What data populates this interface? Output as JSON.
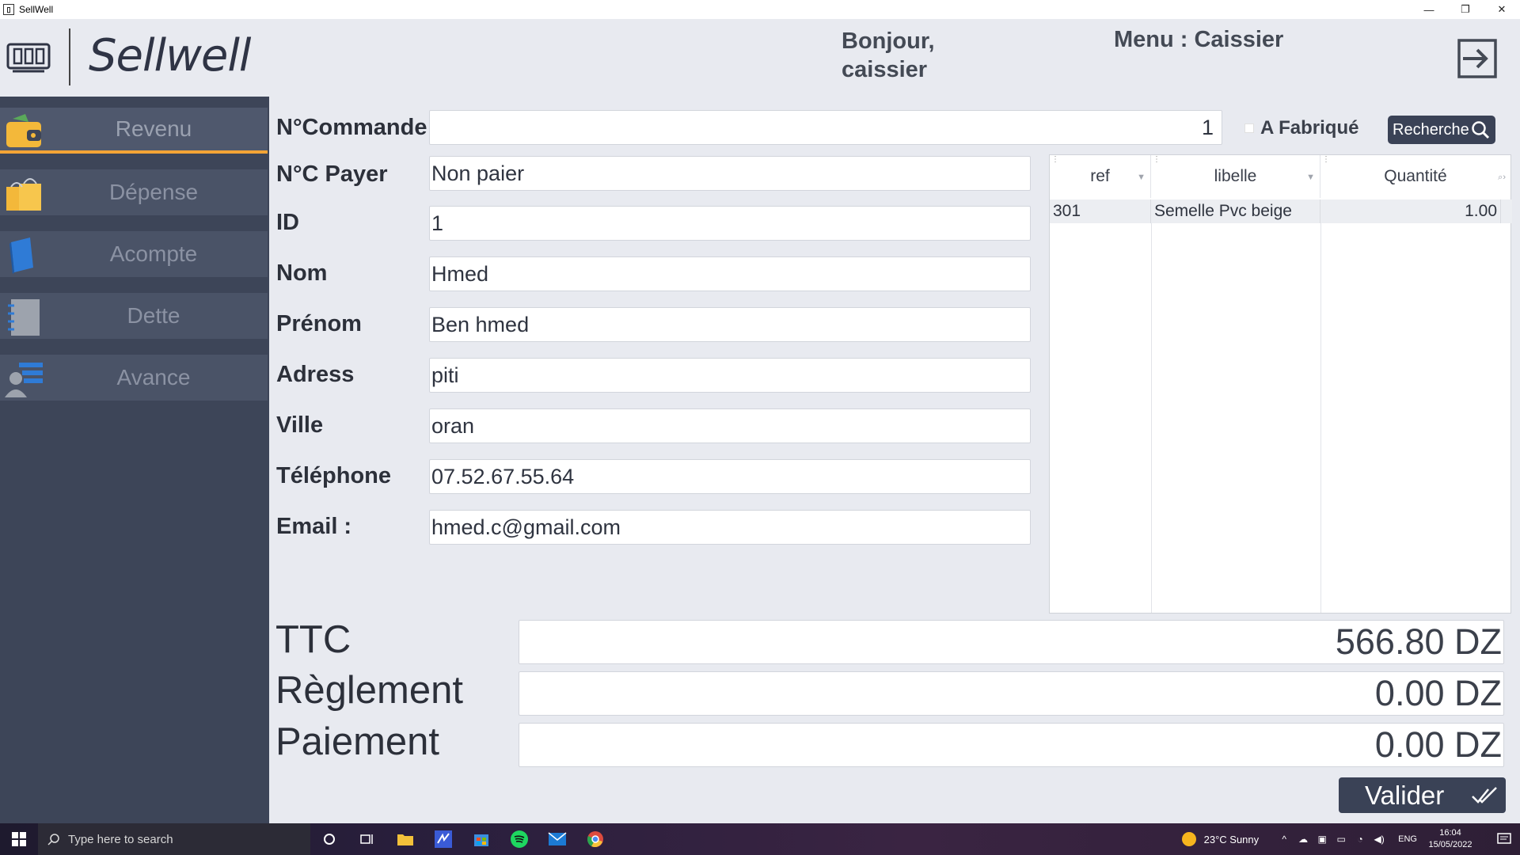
{
  "window": {
    "title": "SellWell",
    "minimize": "—",
    "restore": "❐",
    "close": "✕"
  },
  "header": {
    "logo_text": "Sellwell",
    "greeting": "Bonjour, caissier",
    "menu_title": "Menu : Caissier"
  },
  "sidebar": {
    "items": [
      {
        "label": "Revenu",
        "icon": "wallet-icon",
        "active": true
      },
      {
        "label": "Dépense",
        "icon": "shopping-bag-icon"
      },
      {
        "label": "Acompte",
        "icon": "book-icon"
      },
      {
        "label": "Dette",
        "icon": "notebook-icon"
      },
      {
        "label": "Avance",
        "icon": "user-list-icon"
      }
    ]
  },
  "form": {
    "commande": {
      "label": "N°Commande",
      "value": "1"
    },
    "a_fabrique": {
      "label": "A Fabriqué",
      "checked": false
    },
    "search_button": "Recherche",
    "payer": {
      "label": "N°C Payer",
      "value": "Non paier"
    },
    "id": {
      "label": "ID",
      "value": "1"
    },
    "nom": {
      "label": "Nom",
      "value": "Hmed"
    },
    "prenom": {
      "label": "Prénom",
      "value": "Ben hmed"
    },
    "adress": {
      "label": "Adress",
      "value": "piti"
    },
    "ville": {
      "label": "Ville",
      "value": "oran"
    },
    "telephone": {
      "label": "Téléphone",
      "value": "07.52.67.55.64"
    },
    "email": {
      "label": "Email :",
      "value": "hmed.c@gmail.com"
    }
  },
  "grid": {
    "columns": [
      "ref",
      "libelle",
      "Quantité"
    ],
    "rows": [
      {
        "ref": "301",
        "libelle": "Semelle Pvc beige",
        "quantite": "1.00"
      }
    ]
  },
  "totals": {
    "ttc": {
      "label": "TTC",
      "value": "566.80 DZ"
    },
    "reglement": {
      "label": "Règlement",
      "value": "0.00 DZ"
    },
    "paiement": {
      "label": "Paiement",
      "value": "0.00 DZ"
    }
  },
  "valider_button": "Valider",
  "taskbar": {
    "search_placeholder": "Type here to search",
    "weather": "23°C  Sunny",
    "lang": "ENG",
    "time": "16:04",
    "date": "15/05/2022"
  },
  "colors": {
    "accent": "#f3a436",
    "sidebar": "#3d4558",
    "button": "#3a4256"
  }
}
